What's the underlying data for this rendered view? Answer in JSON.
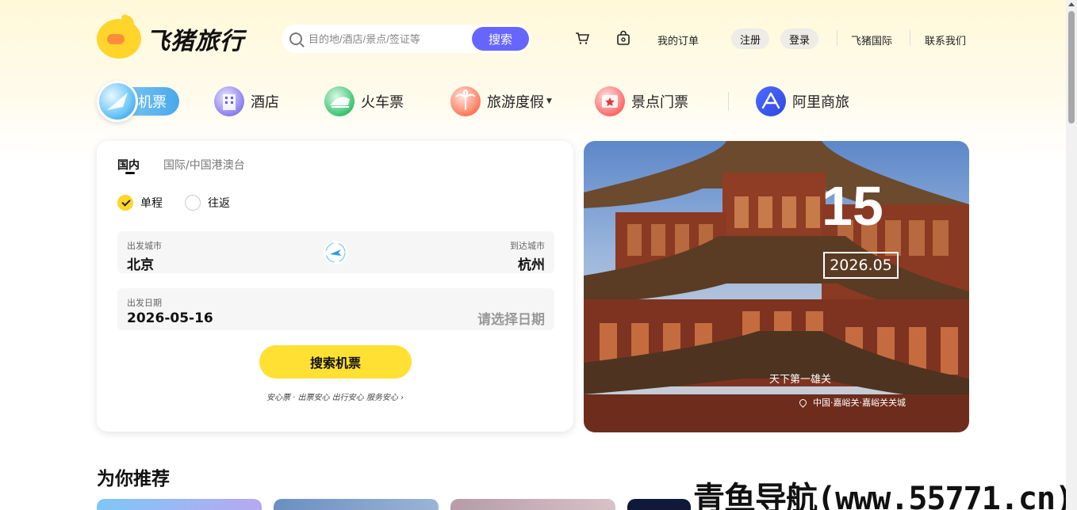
{
  "brand": {
    "name": "飞猪旅行",
    "logo_icon": "pig-logo-icon"
  },
  "search": {
    "placeholder": "目的地/酒店/景点/签证等",
    "button_label": "搜索",
    "accent": "#6666ff"
  },
  "top_links": {
    "cart_icon": "cart-icon",
    "bag_icon": "bag-icon",
    "orders": "我的订单",
    "register": "注册",
    "login": "登录",
    "international": "飞猪国际",
    "contact": "联系我们"
  },
  "nav": {
    "items": [
      {
        "label": "机票",
        "icon": "plane-icon",
        "active": true
      },
      {
        "label": "酒店",
        "icon": "hotel-icon"
      },
      {
        "label": "火车票",
        "icon": "train-icon"
      },
      {
        "label": "旅游度假",
        "icon": "vacation-icon",
        "has_dropdown": true
      },
      {
        "label": "景点门票",
        "icon": "ticket-icon"
      },
      {
        "label": "阿里商旅",
        "icon": "alibiz-icon"
      }
    ]
  },
  "booking": {
    "tabs": [
      "国内",
      "国际/中国港澳台"
    ],
    "trip_types": [
      {
        "label": "单程",
        "checked": true
      },
      {
        "label": "往返",
        "checked": false
      }
    ],
    "from": {
      "label": "出发城市",
      "value": "北京"
    },
    "to": {
      "label": "到达城市",
      "value": "杭州"
    },
    "date": {
      "label": "出发日期",
      "value": "2026-05-16",
      "placeholder": "请选择日期"
    },
    "submit_label": "搜索机票",
    "assurance": "安心票 · 出票安心 出行安心 服务安心 ›",
    "accent": "#ffe033"
  },
  "hero": {
    "day": "15",
    "year_month": "2026.05",
    "title": "天下第一雄关",
    "location": "中国·嘉峪关·嘉峪关关城"
  },
  "recommend": {
    "title": "为你推荐"
  },
  "watermark": "青鱼导航(www.55771.cn)"
}
